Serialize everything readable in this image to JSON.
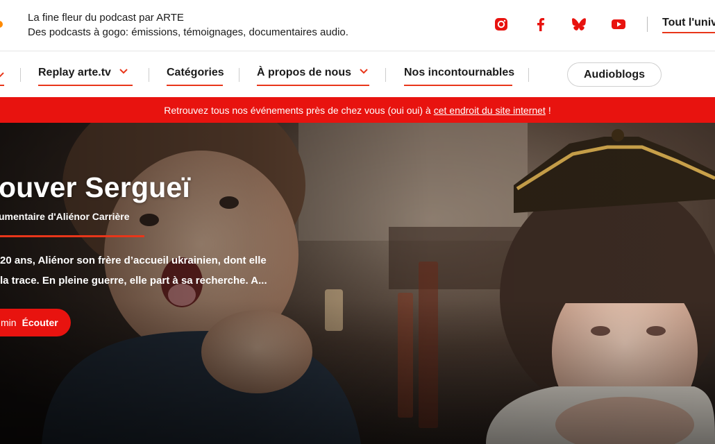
{
  "header": {
    "tagline_line1": "La fine fleur du podcast par ARTE",
    "tagline_line2": "Des podcasts à gogo: émissions, témoignages, documentaires audio.",
    "socials": [
      "instagram-icon",
      "facebook-icon",
      "bluesky-icon",
      "youtube-icon"
    ],
    "universe_link": "Tout l'univ"
  },
  "nav": {
    "items": [
      {
        "label": "Replay arte.tv",
        "has_dropdown": true
      },
      {
        "label": "Catégories",
        "has_dropdown": false
      },
      {
        "label": "À propos de nous",
        "has_dropdown": true
      },
      {
        "label": "Nos incontournables",
        "has_dropdown": false
      }
    ],
    "audioblogs": "Audioblogs"
  },
  "banner": {
    "text_before": "Retrouvez tous nos événements près de chez vous (oui oui) à",
    "link_text": "cet endroit du site internet",
    "text_after": "!"
  },
  "hero": {
    "title": "ouver Sergueï",
    "subtitle": "umentaire d'Aliénor Carrière",
    "description": "20 ans, Aliénor son frère d'accueil ukrainien, dont elle la trace. En pleine guerre, elle part à sa recherche. A...",
    "description_line1": "20 ans, Aliénor son frère d’accueil ukrainien, dont elle",
    "description_line2": "la trace. En pleine guerre, elle part à sa recherche. A...",
    "listen_duration": "min",
    "listen_label": "Écouter"
  },
  "colors": {
    "accent": "#e8361a",
    "banner": "#e8130f",
    "logo": "#ff8a00"
  }
}
